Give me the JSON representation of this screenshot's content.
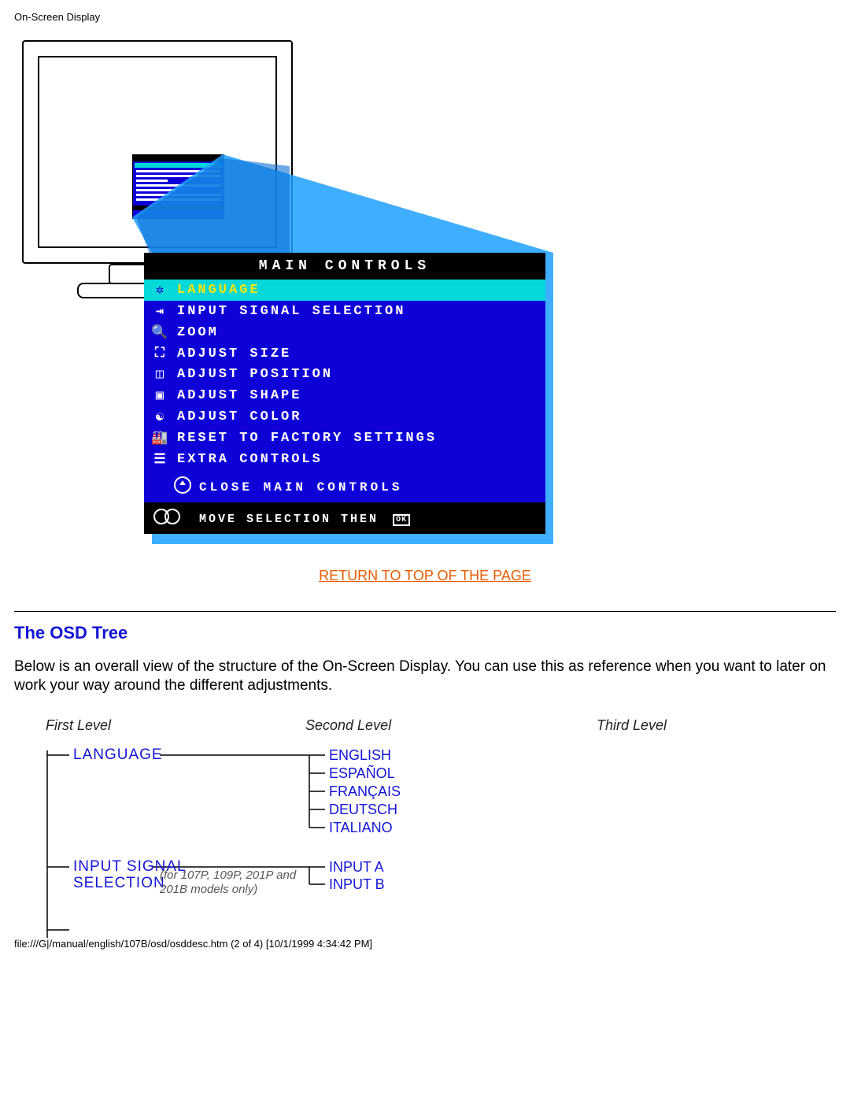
{
  "header": "On-Screen Display",
  "osd": {
    "title": "MAIN CONTROLS",
    "items": [
      "LANGUAGE",
      "INPUT SIGNAL SELECTION",
      "ZOOM",
      "ADJUST SIZE",
      "ADJUST POSITION",
      "ADJUST SHAPE",
      "ADJUST COLOR",
      "RESET TO FACTORY SETTINGS",
      "EXTRA CONTROLS"
    ],
    "close": "CLOSE MAIN CONTROLS",
    "footer": "MOVE SELECTION THEN",
    "footer_ok": "OK"
  },
  "return_link": "RETURN TO TOP OF THE PAGE",
  "section_heading": "The OSD Tree",
  "body_text": "Below is an overall view of the structure of the On-Screen Display. You can use this as reference when you want to later on work your way around the different adjustments.",
  "tree": {
    "levels": {
      "l1": "First Level",
      "l2": "Second Level",
      "l3": "Third Level"
    },
    "language": {
      "label": "LANGUAGE",
      "children": [
        "ENGLISH",
        "ESPAÑOL",
        "FRANÇAIS",
        "DEUTSCH",
        "ITALIANO"
      ]
    },
    "input_signal": {
      "label_line1": "INPUT SIGNAL",
      "label_line2": "SELECTION",
      "note_line1": "(for 107P, 109P, 201P and",
      "note_line2": "201B models only)",
      "children": [
        "INPUT A",
        "INPUT B"
      ]
    }
  },
  "footer_path": "file:///G|/manual/english/107B/osd/osddesc.htm (2 of 4) [10/1/1999 4:34:42 PM]"
}
